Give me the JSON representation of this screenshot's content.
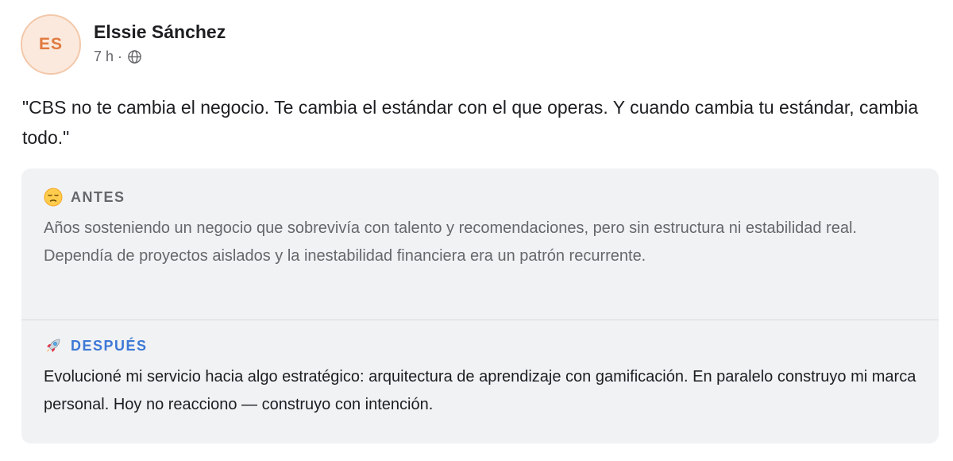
{
  "author": {
    "initials": "ES",
    "name": "Elssie Sánchez",
    "time": "7 h",
    "separator": "·",
    "audience_icon": "globe-icon"
  },
  "post": {
    "quote": "\"CBS no te cambia el negocio. Te cambia el estándar con el que operas. Y cuando cambia tu estándar, cambia todo.\""
  },
  "before": {
    "icon": "pensive-face-emoji",
    "label": "ANTES",
    "text": "Años sosteniendo un negocio que sobrevivía con talento y recomendaciones, pero sin estructura ni estabilidad real. Dependía de proyectos aislados y la inestabilidad financiera era un patrón recurrente."
  },
  "after": {
    "icon": "rocket-emoji",
    "label": "DESPUÉS",
    "text": "Evolucioné mi servicio hacia algo estratégico: arquitectura de aprendizaje con gamificación. En paralelo construyo mi marca personal. Hoy no reacciono — construyo con intención."
  },
  "colors": {
    "avatar_bg": "#fbe9dd",
    "avatar_text": "#e07a3f",
    "card_bg": "#f1f2f4",
    "before_label": "#65676b",
    "after_label": "#3d79d6"
  }
}
